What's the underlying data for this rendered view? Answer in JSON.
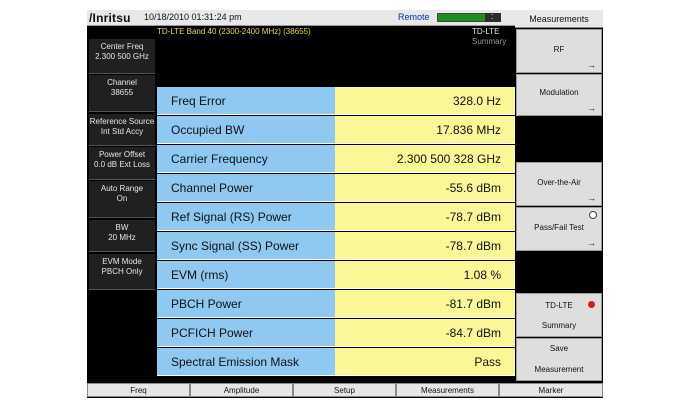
{
  "header": {
    "logo": "/Inritsu",
    "datetime": "10/18/2010 01:31:24 pm",
    "remote": "Remote",
    "indicator_colon": ":"
  },
  "info": {
    "band": "TD-LTE Band 40 (2300-2400 MHz) (38655)",
    "mode": "TD-LTE",
    "view": "Summary"
  },
  "left_panel": [
    {
      "line1": "Center Freq",
      "line2": "2.300 500 GHz"
    },
    {
      "line1": "Channel",
      "line2": "38655"
    },
    {
      "line1": "Reference Source",
      "line2": "Int Std Accy"
    },
    {
      "line1": "Power Offset",
      "line2": "0.0 dB Ext Loss"
    },
    {
      "line1": "Auto Range",
      "line2": "On"
    },
    {
      "line1": "BW",
      "line2": "20 MHz"
    },
    {
      "line1": "EVM Mode",
      "line2": "PBCH Only"
    }
  ],
  "measurements": [
    {
      "label": "Freq Error",
      "value": "328.0 Hz"
    },
    {
      "label": "Occupied BW",
      "value": "17.836 MHz"
    },
    {
      "label": "Carrier Frequency",
      "value": "2.300 500 328 GHz"
    },
    {
      "label": "Channel Power",
      "value": "-55.6 dBm"
    },
    {
      "label": "Ref Signal (RS) Power",
      "value": "-78.7 dBm"
    },
    {
      "label": "Sync Signal (SS) Power",
      "value": "-78.7 dBm"
    },
    {
      "label": "EVM (rms)",
      "value": "1.08 %"
    },
    {
      "label": "PBCH Power",
      "value": "-81.7 dBm"
    },
    {
      "label": "PCFICH Power",
      "value": "-84.7 dBm"
    },
    {
      "label": "Spectral Emission Mask",
      "value": "Pass"
    }
  ],
  "softkeys": {
    "title": "Measurements",
    "rf": "RF",
    "modulation": "Modulation",
    "over_the_air": "Over-the-Air",
    "pass_fail": "Pass/Fail Test",
    "tdlte": "TD-LTE",
    "tdlte_sub": "Summary",
    "save": "Save",
    "save_sub": "Measurement",
    "arrow": "→"
  },
  "bottom_tabs": [
    "Freq",
    "Amplitude",
    "Setup",
    "Measurements",
    "Marker"
  ],
  "colors": {
    "label_cell": "#8fc8f1",
    "value_cell": "#faf896",
    "indicator": "#1f8d1f",
    "status_red": "#d51f1f",
    "band_text": "#e7d84c"
  }
}
